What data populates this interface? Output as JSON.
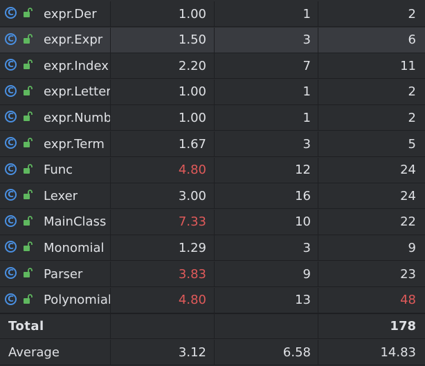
{
  "rows": [
    {
      "name": "expr.Der",
      "v1": "1.00",
      "v2": "1",
      "v3": "2",
      "v1_red": false,
      "v3_red": false,
      "selected": false
    },
    {
      "name": "expr.Expr",
      "v1": "1.50",
      "v2": "3",
      "v3": "6",
      "v1_red": false,
      "v3_red": false,
      "selected": true
    },
    {
      "name": "expr.Index",
      "v1": "2.20",
      "v2": "7",
      "v3": "11",
      "v1_red": false,
      "v3_red": false,
      "selected": false
    },
    {
      "name": "expr.Letter",
      "v1": "1.00",
      "v2": "1",
      "v3": "2",
      "v1_red": false,
      "v3_red": false,
      "selected": false
    },
    {
      "name": "expr.Number",
      "v1": "1.00",
      "v2": "1",
      "v3": "2",
      "v1_red": false,
      "v3_red": false,
      "selected": false
    },
    {
      "name": "expr.Term",
      "v1": "1.67",
      "v2": "3",
      "v3": "5",
      "v1_red": false,
      "v3_red": false,
      "selected": false
    },
    {
      "name": "Func",
      "v1": "4.80",
      "v2": "12",
      "v3": "24",
      "v1_red": true,
      "v3_red": false,
      "selected": false
    },
    {
      "name": "Lexer",
      "v1": "3.00",
      "v2": "16",
      "v3": "24",
      "v1_red": false,
      "v3_red": false,
      "selected": false
    },
    {
      "name": "MainClass",
      "v1": "7.33",
      "v2": "10",
      "v3": "22",
      "v1_red": true,
      "v3_red": false,
      "selected": false
    },
    {
      "name": "Monomial",
      "v1": "1.29",
      "v2": "3",
      "v3": "9",
      "v1_red": false,
      "v3_red": false,
      "selected": false
    },
    {
      "name": "Parser",
      "v1": "3.83",
      "v2": "9",
      "v3": "23",
      "v1_red": true,
      "v3_red": false,
      "selected": false
    },
    {
      "name": "Polynomial",
      "v1": "4.80",
      "v2": "13",
      "v3": "48",
      "v1_red": true,
      "v3_red": true,
      "selected": false
    }
  ],
  "total": {
    "label": "Total",
    "v1": "",
    "v2": "",
    "v3": "178"
  },
  "average": {
    "label": "Average",
    "v1": "3.12",
    "v2": "6.58",
    "v3": "14.83"
  },
  "icons": {
    "class_icon": "class-icon",
    "lock_icon": "unlocked-lock-icon",
    "class_glyph": "C"
  },
  "colors": {
    "warning": "#e05a5a",
    "class_icon": "#4a90e2",
    "lock_icon": "#5fb85f"
  }
}
